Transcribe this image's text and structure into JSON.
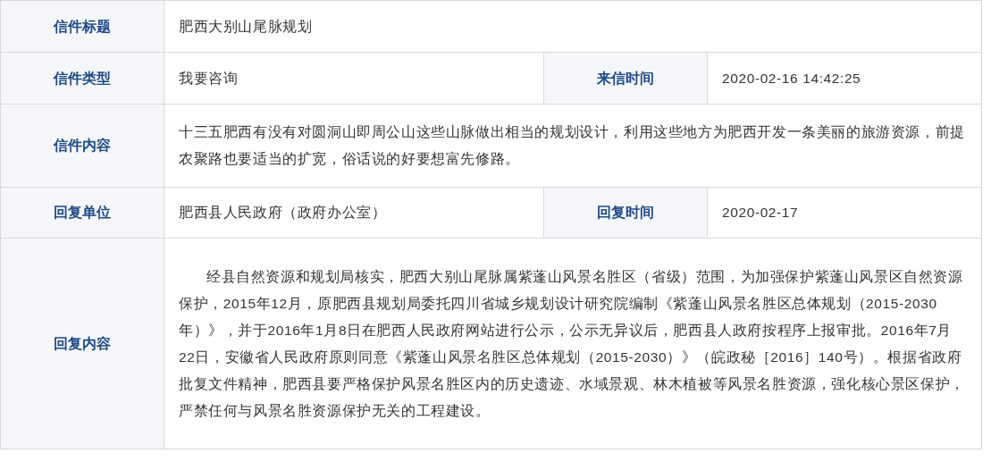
{
  "rows": [
    {
      "fields": [
        {
          "label": "信件标题",
          "value": "肥西大别山尾脉规划"
        }
      ]
    },
    {
      "fields": [
        {
          "label": "信件类型",
          "value": "我要咨询"
        },
        {
          "label": "来信时间",
          "value": "2020-02-16 14:42:25"
        }
      ]
    },
    {
      "fields": [
        {
          "label": "信件内容",
          "value": "十三五肥西有没有对圆洞山即周公山这些山脉做出相当的规划设计，利用这些地方为肥西开发一条美丽的旅游资源，前提农聚路也要适当的扩宽，俗话说的好要想富先修路。"
        }
      ]
    },
    {
      "fields": [
        {
          "label": "回复单位",
          "value": "肥西县人民政府（政府办公室）"
        },
        {
          "label": "回复时间",
          "value": "2020-02-17"
        }
      ]
    },
    {
      "fields": [
        {
          "label": "回复内容",
          "value": "经县自然资源和规划局核实，肥西大别山尾脉属紫蓬山风景名胜区（省级）范围，为加强保护紫蓬山风景区自然资源保护，2015年12月，原肥西县规划局委托四川省城乡规划设计研究院编制《紫蓬山风景名胜区总体规划（2015-2030年）》，并于2016年1月8日在肥西人民政府网站进行公示，公示无异议后，肥西县人政府按程序上报审批。2016年7月22日，安徽省人民政府原则同意《紫蓬山风景名胜区总体规划（2015-2030）》（皖政秘［2016］140号）。根据省政府批复文件精神，肥西县要严格保护风景名胜区内的历史遗迹、水域景观、林木植被等风景名胜资源，强化核心景区保护，严禁任何与风景名胜资源保护无关的工程建设。",
          "indent": true
        }
      ]
    }
  ]
}
